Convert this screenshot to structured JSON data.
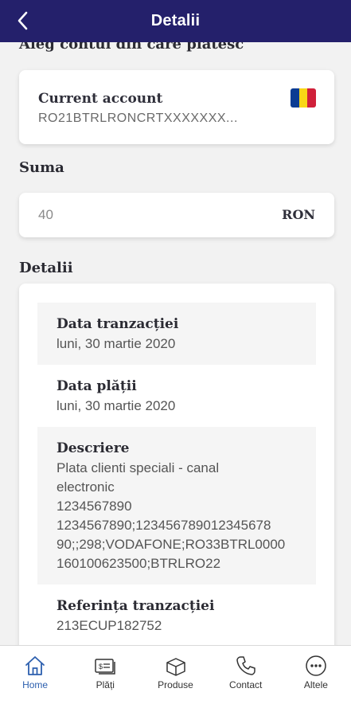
{
  "header": {
    "title": "Detalii",
    "back_icon": "chevron-left-icon"
  },
  "payer_section": {
    "label": "Aleg contul din care platesc"
  },
  "account": {
    "name": "Current account",
    "iban": "RO21BTRLRONCRTXXXXXXX...",
    "flag_icon": "romania-flag-icon",
    "flag_colors": [
      "#0b3c93",
      "#f9d616",
      "#d0203a"
    ]
  },
  "amount_section": {
    "label": "Suma"
  },
  "amount": {
    "value": "40",
    "currency": "RON"
  },
  "details_section": {
    "label": "Detalii",
    "rows": [
      {
        "label": "Data tranzacției",
        "value": "luni, 30 martie 2020"
      },
      {
        "label": "Data plății",
        "value": "luni, 30 martie 2020"
      },
      {
        "label": "Descriere",
        "lines": [
          "Plata clienti speciali - canal",
          "electronic",
          "1234567890",
          "1234567890;123456789012345678",
          "90;;298;VODAFONE;RO33BTRL0000",
          "160100623500;BTRLRO22"
        ]
      },
      {
        "label": "Referința tranzacției",
        "value": "213ECUP182752"
      }
    ]
  },
  "nav": [
    {
      "label": "Home",
      "icon": "home-icon",
      "active": true
    },
    {
      "label": "Plăți",
      "icon": "bill-icon",
      "active": false
    },
    {
      "label": "Produse",
      "icon": "box-icon",
      "active": false
    },
    {
      "label": "Contact",
      "icon": "phone-icon",
      "active": false
    },
    {
      "label": "Altele",
      "icon": "more-icon",
      "active": false
    }
  ],
  "colors": {
    "header_bg": "#24206b",
    "active_nav": "#2c5fae",
    "page_bg": "#f2f2f2"
  }
}
